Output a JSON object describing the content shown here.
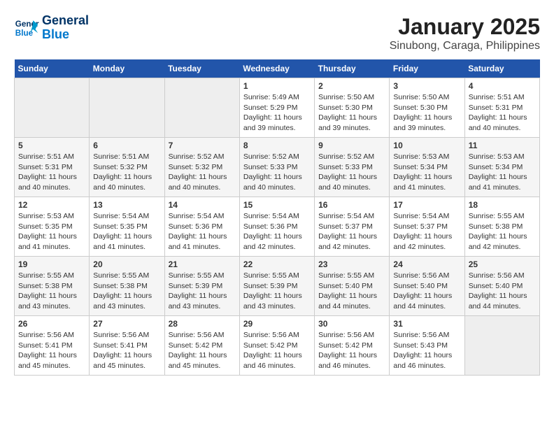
{
  "logo": {
    "line1": "General",
    "line2": "Blue"
  },
  "title": "January 2025",
  "subtitle": "Sinubong, Caraga, Philippines",
  "days_of_week": [
    "Sunday",
    "Monday",
    "Tuesday",
    "Wednesday",
    "Thursday",
    "Friday",
    "Saturday"
  ],
  "weeks": [
    [
      {
        "day": "",
        "info": ""
      },
      {
        "day": "",
        "info": ""
      },
      {
        "day": "",
        "info": ""
      },
      {
        "day": "1",
        "info": "Sunrise: 5:49 AM\nSunset: 5:29 PM\nDaylight: 11 hours\nand 39 minutes."
      },
      {
        "day": "2",
        "info": "Sunrise: 5:50 AM\nSunset: 5:30 PM\nDaylight: 11 hours\nand 39 minutes."
      },
      {
        "day": "3",
        "info": "Sunrise: 5:50 AM\nSunset: 5:30 PM\nDaylight: 11 hours\nand 39 minutes."
      },
      {
        "day": "4",
        "info": "Sunrise: 5:51 AM\nSunset: 5:31 PM\nDaylight: 11 hours\nand 40 minutes."
      }
    ],
    [
      {
        "day": "5",
        "info": "Sunrise: 5:51 AM\nSunset: 5:31 PM\nDaylight: 11 hours\nand 40 minutes."
      },
      {
        "day": "6",
        "info": "Sunrise: 5:51 AM\nSunset: 5:32 PM\nDaylight: 11 hours\nand 40 minutes."
      },
      {
        "day": "7",
        "info": "Sunrise: 5:52 AM\nSunset: 5:32 PM\nDaylight: 11 hours\nand 40 minutes."
      },
      {
        "day": "8",
        "info": "Sunrise: 5:52 AM\nSunset: 5:33 PM\nDaylight: 11 hours\nand 40 minutes."
      },
      {
        "day": "9",
        "info": "Sunrise: 5:52 AM\nSunset: 5:33 PM\nDaylight: 11 hours\nand 40 minutes."
      },
      {
        "day": "10",
        "info": "Sunrise: 5:53 AM\nSunset: 5:34 PM\nDaylight: 11 hours\nand 41 minutes."
      },
      {
        "day": "11",
        "info": "Sunrise: 5:53 AM\nSunset: 5:34 PM\nDaylight: 11 hours\nand 41 minutes."
      }
    ],
    [
      {
        "day": "12",
        "info": "Sunrise: 5:53 AM\nSunset: 5:35 PM\nDaylight: 11 hours\nand 41 minutes."
      },
      {
        "day": "13",
        "info": "Sunrise: 5:54 AM\nSunset: 5:35 PM\nDaylight: 11 hours\nand 41 minutes."
      },
      {
        "day": "14",
        "info": "Sunrise: 5:54 AM\nSunset: 5:36 PM\nDaylight: 11 hours\nand 41 minutes."
      },
      {
        "day": "15",
        "info": "Sunrise: 5:54 AM\nSunset: 5:36 PM\nDaylight: 11 hours\nand 42 minutes."
      },
      {
        "day": "16",
        "info": "Sunrise: 5:54 AM\nSunset: 5:37 PM\nDaylight: 11 hours\nand 42 minutes."
      },
      {
        "day": "17",
        "info": "Sunrise: 5:54 AM\nSunset: 5:37 PM\nDaylight: 11 hours\nand 42 minutes."
      },
      {
        "day": "18",
        "info": "Sunrise: 5:55 AM\nSunset: 5:38 PM\nDaylight: 11 hours\nand 42 minutes."
      }
    ],
    [
      {
        "day": "19",
        "info": "Sunrise: 5:55 AM\nSunset: 5:38 PM\nDaylight: 11 hours\nand 43 minutes."
      },
      {
        "day": "20",
        "info": "Sunrise: 5:55 AM\nSunset: 5:38 PM\nDaylight: 11 hours\nand 43 minutes."
      },
      {
        "day": "21",
        "info": "Sunrise: 5:55 AM\nSunset: 5:39 PM\nDaylight: 11 hours\nand 43 minutes."
      },
      {
        "day": "22",
        "info": "Sunrise: 5:55 AM\nSunset: 5:39 PM\nDaylight: 11 hours\nand 43 minutes."
      },
      {
        "day": "23",
        "info": "Sunrise: 5:55 AM\nSunset: 5:40 PM\nDaylight: 11 hours\nand 44 minutes."
      },
      {
        "day": "24",
        "info": "Sunrise: 5:56 AM\nSunset: 5:40 PM\nDaylight: 11 hours\nand 44 minutes."
      },
      {
        "day": "25",
        "info": "Sunrise: 5:56 AM\nSunset: 5:40 PM\nDaylight: 11 hours\nand 44 minutes."
      }
    ],
    [
      {
        "day": "26",
        "info": "Sunrise: 5:56 AM\nSunset: 5:41 PM\nDaylight: 11 hours\nand 45 minutes."
      },
      {
        "day": "27",
        "info": "Sunrise: 5:56 AM\nSunset: 5:41 PM\nDaylight: 11 hours\nand 45 minutes."
      },
      {
        "day": "28",
        "info": "Sunrise: 5:56 AM\nSunset: 5:42 PM\nDaylight: 11 hours\nand 45 minutes."
      },
      {
        "day": "29",
        "info": "Sunrise: 5:56 AM\nSunset: 5:42 PM\nDaylight: 11 hours\nand 46 minutes."
      },
      {
        "day": "30",
        "info": "Sunrise: 5:56 AM\nSunset: 5:42 PM\nDaylight: 11 hours\nand 46 minutes."
      },
      {
        "day": "31",
        "info": "Sunrise: 5:56 AM\nSunset: 5:43 PM\nDaylight: 11 hours\nand 46 minutes."
      },
      {
        "day": "",
        "info": ""
      }
    ]
  ]
}
